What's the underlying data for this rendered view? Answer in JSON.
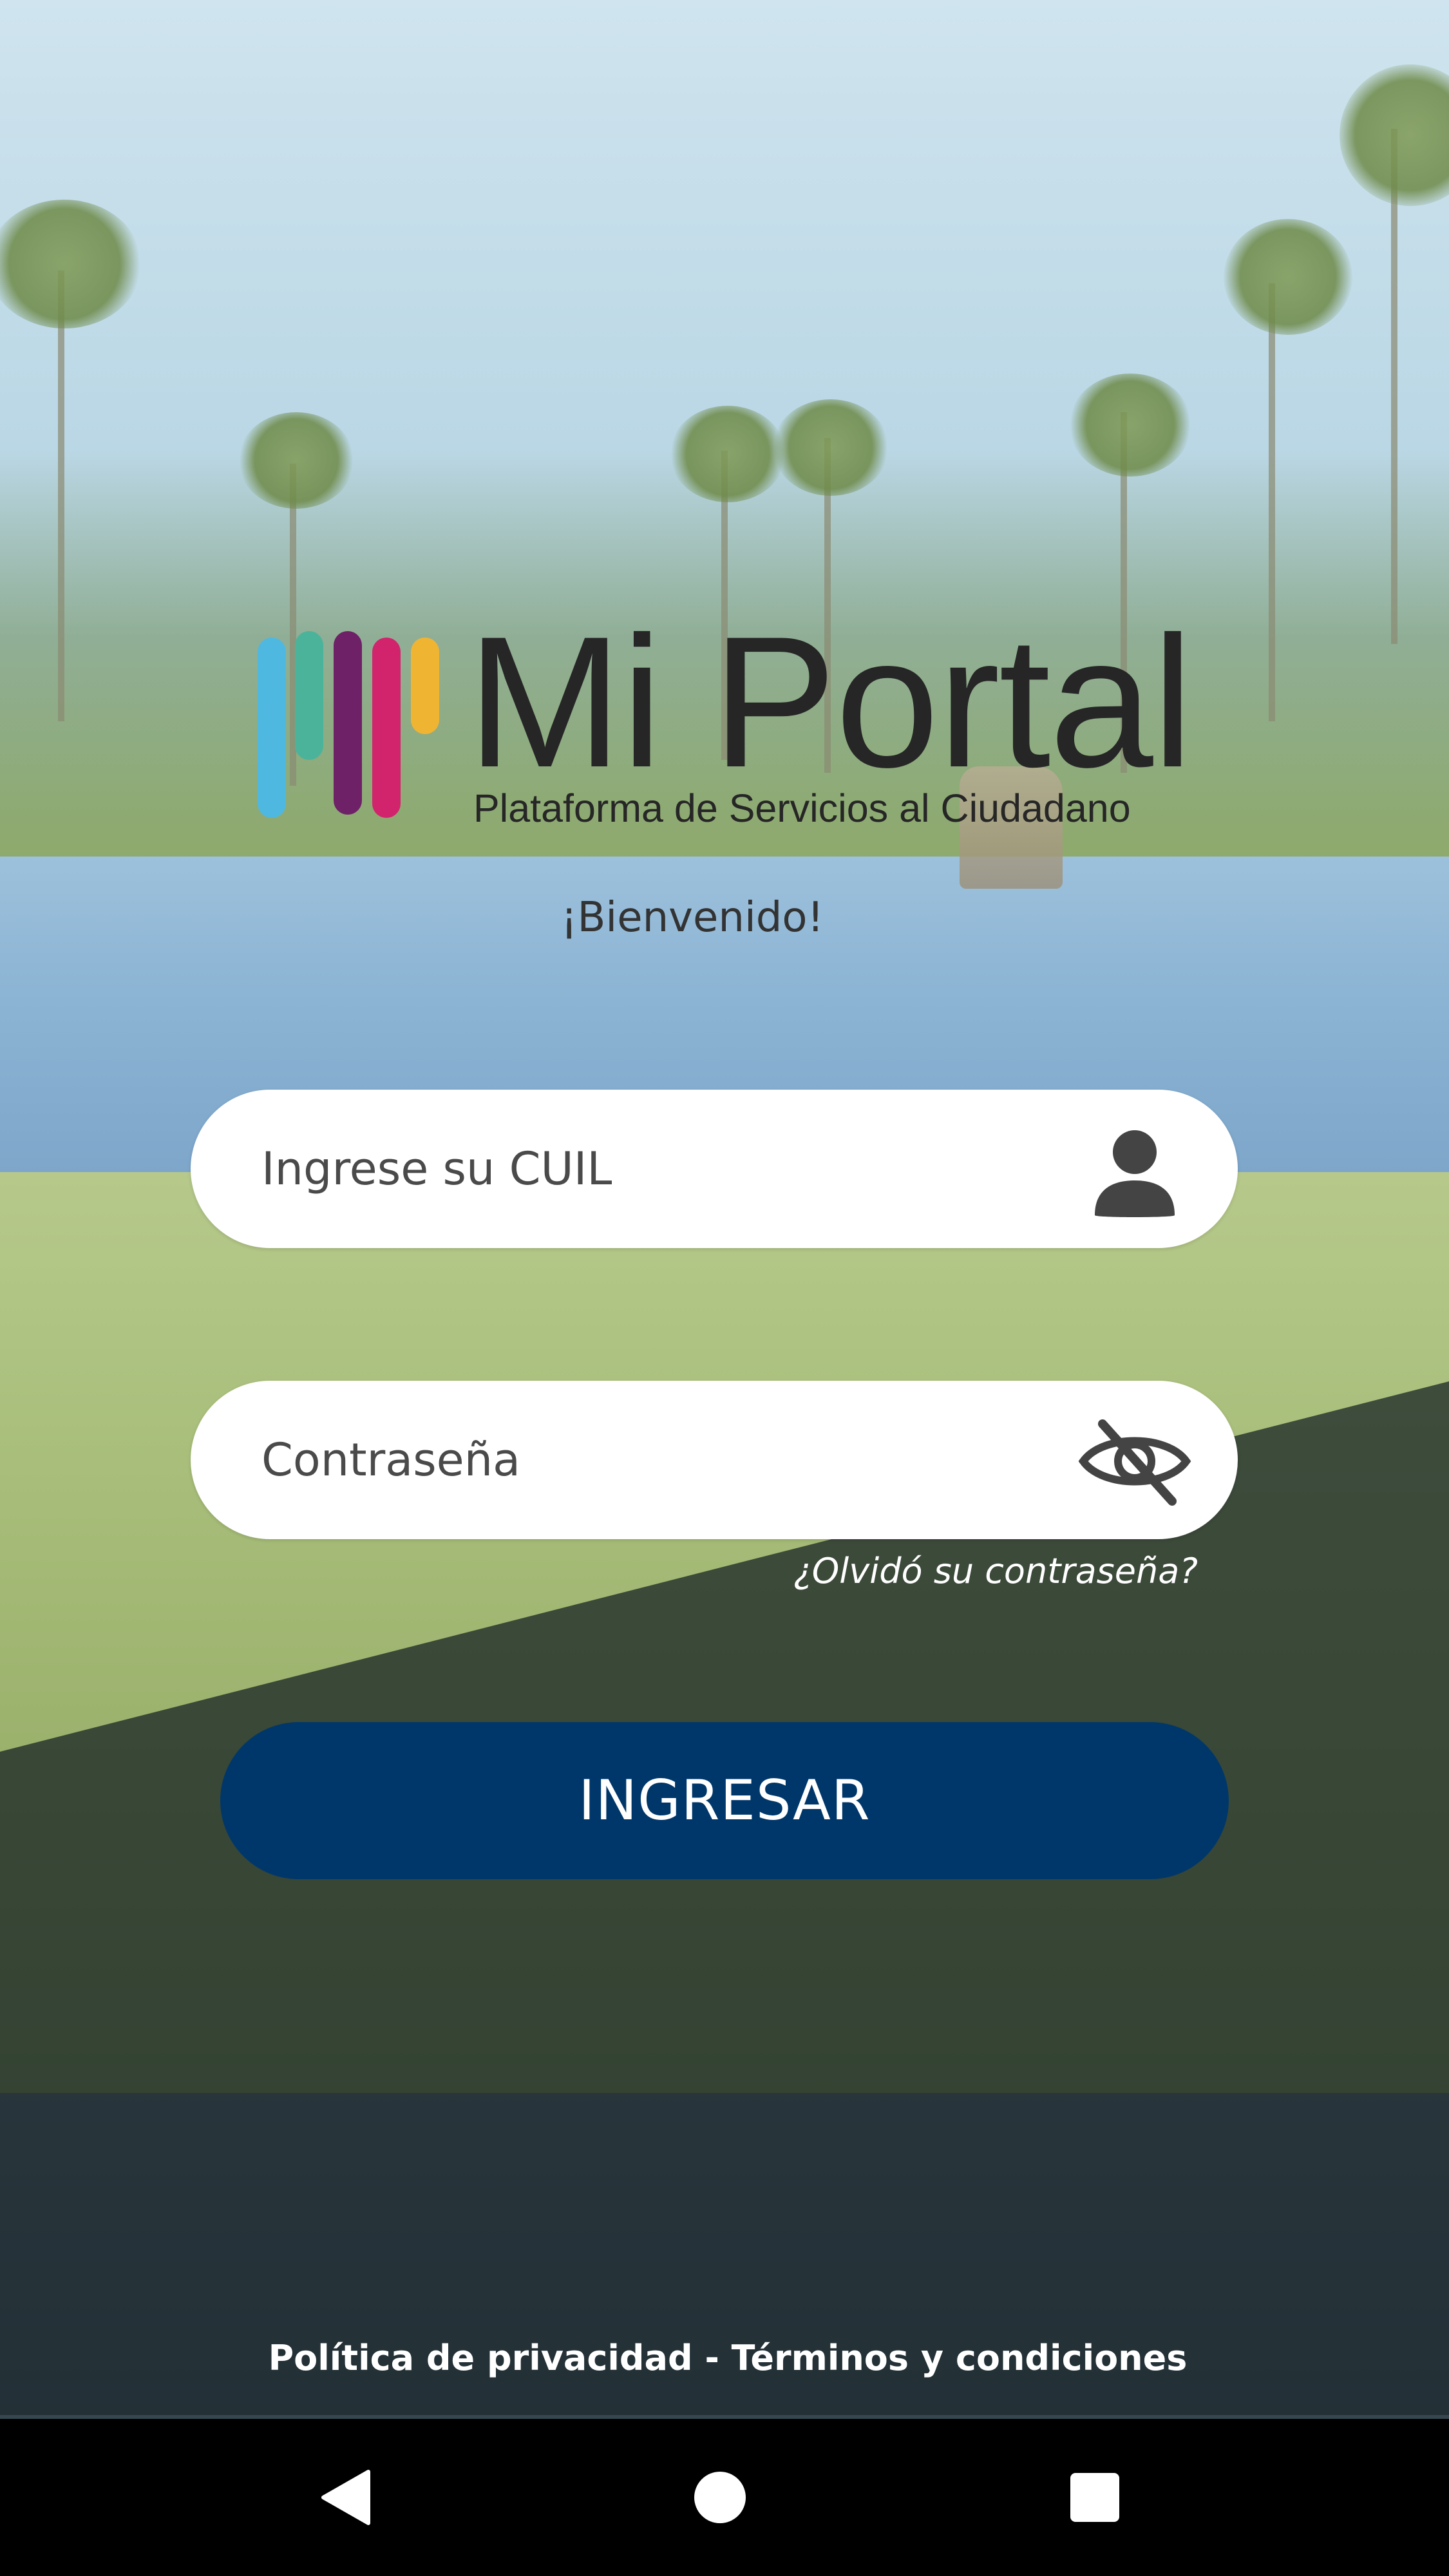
{
  "brand": {
    "name": "Mi Portal",
    "tagline": "Plataforma de Servicios al Ciudadano",
    "bar_colors": [
      "#4fb8e0",
      "#4cb39b",
      "#6e2167",
      "#d1246c",
      "#f0b433"
    ]
  },
  "welcome": "¡Bienvenido!",
  "login": {
    "cuil_placeholder": "Ingrese su CUIL",
    "cuil_icon": "user-icon",
    "password_placeholder": "Contraseña",
    "password_icon": "eye-off-icon",
    "forgot_password": "¿Olvidó su contraseña?",
    "submit_label": "INGRESAR"
  },
  "footer": {
    "privacy": "Política de privacidad",
    "separator": " - ",
    "terms": "Términos y condiciones"
  },
  "navbar": {
    "back_icon": "back-triangle-icon",
    "home_icon": "home-circle-icon",
    "recents_icon": "recents-square-icon"
  },
  "colors": {
    "primary_button": "#00376b",
    "text_dark": "#262626",
    "field_bg": "#ffffff",
    "navbar_bg": "#000000"
  }
}
